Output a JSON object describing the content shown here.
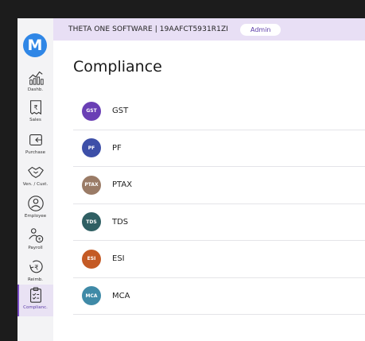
{
  "app": {
    "logo_letter": "M"
  },
  "sidebar": {
    "items": [
      {
        "label": "Dashb.",
        "icon": "dashboard-chart-icon"
      },
      {
        "label": "Sales",
        "icon": "sales-invoice-icon"
      },
      {
        "label": "Purchase",
        "icon": "purchase-icon"
      },
      {
        "label": "Ven. / Cust.",
        "icon": "handshake-icon"
      },
      {
        "label": "Employee",
        "icon": "employee-icon"
      },
      {
        "label": "Payroll",
        "icon": "payroll-icon"
      },
      {
        "label": "Reimb.",
        "icon": "reimbursement-icon"
      },
      {
        "label": "Complianc.",
        "icon": "compliance-clipboard-icon",
        "active": true
      }
    ]
  },
  "header": {
    "company": "THETA ONE SOFTWARE | 19AAFCT5931R1ZI",
    "role": "Admin"
  },
  "page": {
    "title": "Compliance",
    "items": [
      {
        "label": "GST",
        "badge": "GST",
        "color": "#6a3fb5"
      },
      {
        "label": "PF",
        "badge": "PF",
        "color": "#3d4fa8"
      },
      {
        "label": "PTAX",
        "badge": "PTAX",
        "color": "#9a7b66"
      },
      {
        "label": "TDS",
        "badge": "TDS",
        "color": "#2f5f63"
      },
      {
        "label": "ESI",
        "badge": "ESI",
        "color": "#c45a25"
      },
      {
        "label": "MCA",
        "badge": "MCA",
        "color": "#3f8aa7"
      }
    ]
  }
}
